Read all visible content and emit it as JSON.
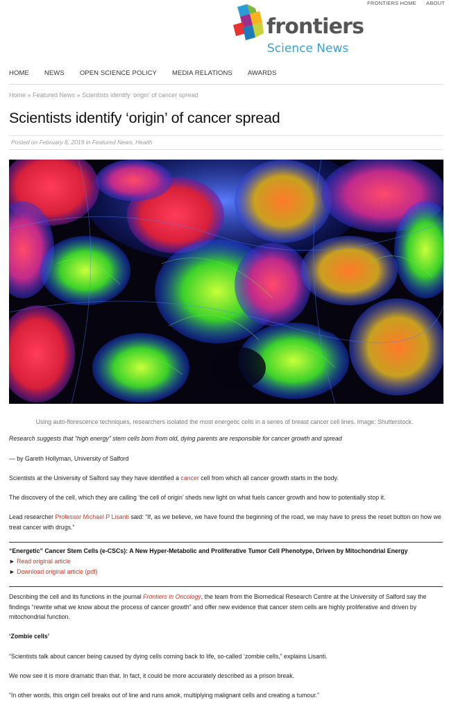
{
  "topbar": {
    "home": "FRONTIERS HOME",
    "about": "ABOUT"
  },
  "logo": {
    "word": "frontiers",
    "sub": "Science News",
    "colors": [
      "#e8322f",
      "#f8b31c",
      "#2a9bd7",
      "#7ab83e",
      "#9a2e8c",
      "#1f7bb8"
    ]
  },
  "nav": [
    "HOME",
    "NEWS",
    "OPEN SCIENCE POLICY",
    "MEDIA RELATIONS",
    "AWARDS"
  ],
  "breadcrumb": {
    "home": "Home",
    "sep": " » ",
    "section": "Featured News",
    "current": "Scientists identify ‘origin’ of cancer spread"
  },
  "article": {
    "title": "Scientists identify ‘origin’ of cancer spread",
    "meta": {
      "posted": "Posted on ",
      "date": "February 8, 2019",
      "in": " in ",
      "cat1": "Featured News",
      "comma": ", ",
      "cat2": "Health"
    },
    "caption": "Using auto-florescence techniques, researchers isolated the most energetic cells in a series of breast cancer cell lines. Image: Shutterstock.",
    "lead": "Research suggests that “high energy” stem cells born from old, dying parents are responsible for cancer growth and spread",
    "byline": "— by Gareth Hollyman, University of Salford",
    "p1a": "Scientists at the University of Salford say they have identified a ",
    "p1link": "cancer",
    "p1b": " cell from which all cancer growth starts in the body.",
    "p2": "The discovery of the cell, which they are calling ‘the cell of origin’ sheds new light on what fuels cancer growth and how to potentially stop it.",
    "p3a": "Lead researcher ",
    "p3link": "Professor Michael P Lisanti",
    "p3b": " said: “If, as we believe, we have found the beginning of the road, we may have to press the reset button on how we treat cancer with drugs.”",
    "box": {
      "title": "“Energetic” Cancer Stem Cells (e-CSCs): A New Hyper-Metabolic and Proliferative Tumor Cell Phenotype, Driven by Mitochondrial Energy",
      "link1": "Read original article",
      "link2": "Download original article (pdf)",
      "arrow": "►"
    },
    "p4a": "Describing the cell and its functions in the journal ",
    "p4link": "Frontiers in Oncology",
    "p4b": ", the team from the Biomedical Research Centre at the University of Salford say the findings “rewrite what we know about the process of cancer growth” and offer new evidence that cancer stem cells are highly proliferative and driven by mitochondrial function.",
    "subhead": "‘Zombie cells’",
    "p5": "“Scientists talk about cancer being caused by dying cells coming back to life, so-called ‘zombie cells,” explains Lisanti.",
    "p6": "We now see it is more dramatic than that. In fact, it could be more accurately described as a prison break.",
    "p7": "“In other words, this origin cell breaks out of line and runs amok, multiplying malignant cells and creating a tumour.”"
  }
}
